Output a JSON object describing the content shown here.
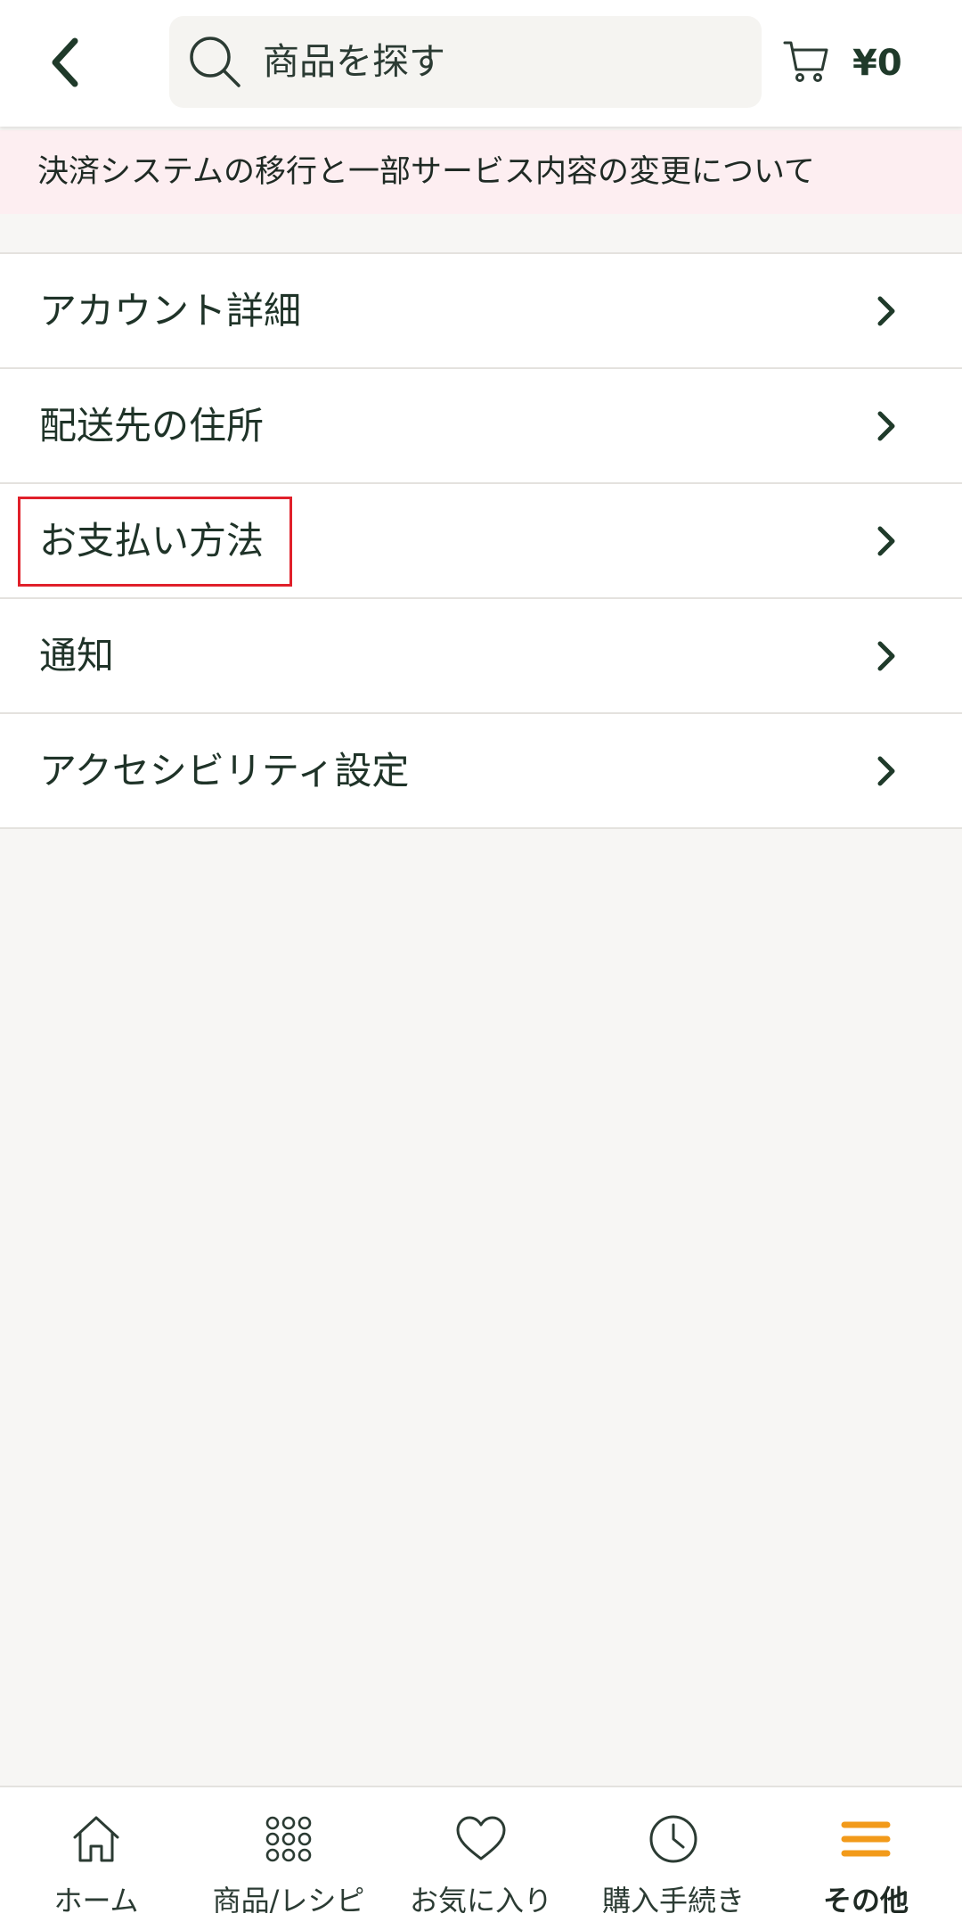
{
  "header": {
    "search_placeholder": "商品を探す",
    "cart_total": "¥0"
  },
  "notice": {
    "text": "決済システムの移行と一部サービス内容の変更について"
  },
  "menu": {
    "items": [
      {
        "label": "アカウント詳細"
      },
      {
        "label": "配送先の住所"
      },
      {
        "label": "お支払い方法"
      },
      {
        "label": "通知"
      },
      {
        "label": "アクセシビリティ設定"
      }
    ]
  },
  "tabbar": {
    "items": [
      {
        "label": "ホーム",
        "icon": "home-icon"
      },
      {
        "label": "商品/レシピ",
        "icon": "grid-icon"
      },
      {
        "label": "お気に入り",
        "icon": "heart-icon"
      },
      {
        "label": "購入手続き",
        "icon": "clock-icon"
      },
      {
        "label": "その他",
        "icon": "menu-icon",
        "active": true
      }
    ]
  },
  "colors": {
    "primary": "#1f3a2a",
    "accent": "#f29a1a",
    "notice_bg": "#fdeef1",
    "highlight": "#e0202a"
  }
}
